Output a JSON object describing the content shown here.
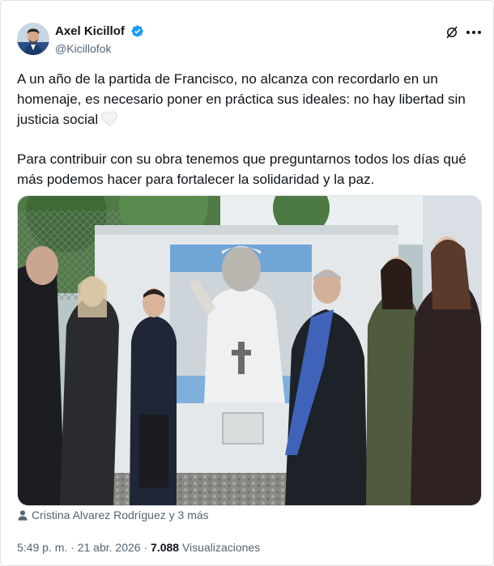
{
  "tweet": {
    "author_name": "Axel Kicillof",
    "handle": "@Kicillofok",
    "paragraph1": "A un año de la partida de Francisco, no alcanza con recordarlo en un homenaje, es necesario poner en práctica sus ideales: no hay libertad sin justicia social",
    "paragraph2": "Para contribuir con su obra tenemos que preguntarnos todos los días qué más podemos hacer para fortalecer la solidaridad y la paz.",
    "tagged_people": "Cristina Alvarez Rodríguez y 3 más",
    "time": "5:49 p. m.",
    "separator": "·",
    "date": "21 abr. 2026",
    "views_count": "7.088",
    "views_label": "Visualizaciones"
  },
  "icons": {
    "verified": "verified-badge-icon",
    "grok": "grok-icon",
    "more": "more-icon",
    "heart": "white-heart-emoji",
    "tagged": "person-icon"
  },
  "colors": {
    "verified_blue": "#1d9bf0",
    "text_primary": "#0f1419",
    "text_secondary": "#536471"
  }
}
